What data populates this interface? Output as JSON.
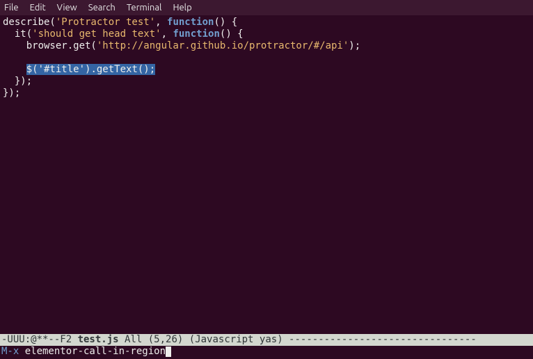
{
  "menubar": {
    "file": "File",
    "edit": "Edit",
    "view": "View",
    "search": "Search",
    "terminal": "Terminal",
    "help": "Help"
  },
  "code": {
    "line1_describe": "describe(",
    "line1_str": "'Protractor test'",
    "line1_mid": ", ",
    "line1_fn": "function",
    "line1_end": "() {",
    "line2_indent": "  it(",
    "line2_str": "'should get head text'",
    "line2_mid": ", ",
    "line2_fn": "function",
    "line2_end": "() {",
    "line3_pre": "    browser.get(",
    "line3_str": "'http://angular.github.io/protractor/#/api'",
    "line3_end": ");",
    "line4": "",
    "line5_indent": "    ",
    "line5_hl_pre": "$(",
    "line5_hl_str": "'#title'",
    "line5_hl_post": ").getText();",
    "line6": "  });",
    "line7": "});"
  },
  "modeline": {
    "prefix": "-UUU:@**--F2  ",
    "filename": "test.js",
    "spacer": "      ",
    "position": "All (5,26)",
    "spacer2": "      ",
    "mode": "(Javascript yas)",
    "dashes": " --------------------------------"
  },
  "minibuffer": {
    "prompt": "M-x ",
    "command": "elementor-call-in-region"
  }
}
